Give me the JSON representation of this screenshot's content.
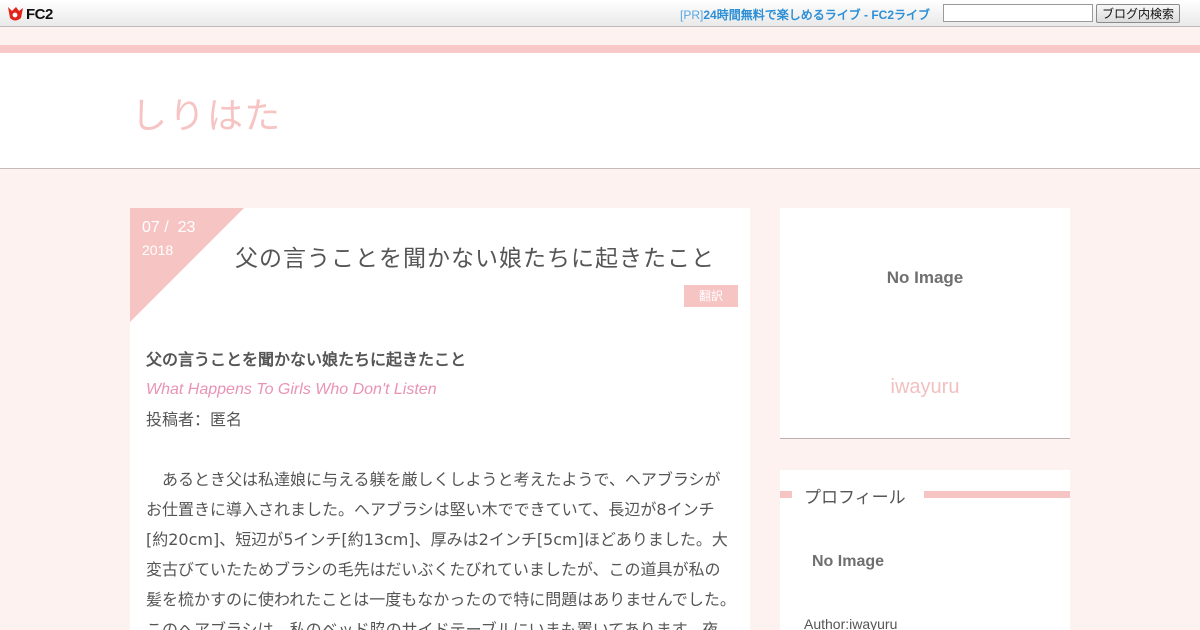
{
  "topbar": {
    "logo_text": "FC2",
    "pr_prefix": "[PR]",
    "pr_text": "24時間無料で楽しめるライブ - FC2ライブ",
    "search_value": "",
    "search_button": "ブログ内検索"
  },
  "header": {
    "blog_title": "しりはた"
  },
  "article": {
    "date_month": "07",
    "date_separator": "/",
    "date_day": "23",
    "date_year": "2018",
    "title": "父の言うことを聞かない娘たちに起きたこと",
    "category": "翻訳",
    "body_title": "父の言うことを聞かない娘たちに起きたこと",
    "body_en_title": "What Happens To Girls Who Don't Listen",
    "body_author": "投稿者：匿名",
    "body_paragraph": "あるとき父は私達娘に与える躾を厳しくしようと考えたようで、ヘアブラシがお仕置きに導入されました。ヘアブラシは堅い木でできていて、長辺が8インチ[約20cm]、短辺が5インチ[約13cm]、厚みは2インチ[5cm]ほどありました。大変古びていたためブラシの毛先はだいぶくたびれていましたが、この道具が私の髪を梳かすのに使われたことは一度もなかったので特に問題はありませんでした。このヘアブラシは、私のベッド脇のサイドテーブルにいまも置いてあります。夜"
  },
  "sidebar": {
    "no_image_label": "No Image",
    "author_name": "iwayuru"
  },
  "profile": {
    "heading": "プロフィール",
    "no_image_label": "No Image",
    "author_line": "Author:iwayuru"
  },
  "colors": {
    "accent_pink": "#f7c4c4",
    "link_blue": "#2d8fd5",
    "en_title_pink": "#e993b4",
    "page_bg": "#fdf2f0"
  }
}
